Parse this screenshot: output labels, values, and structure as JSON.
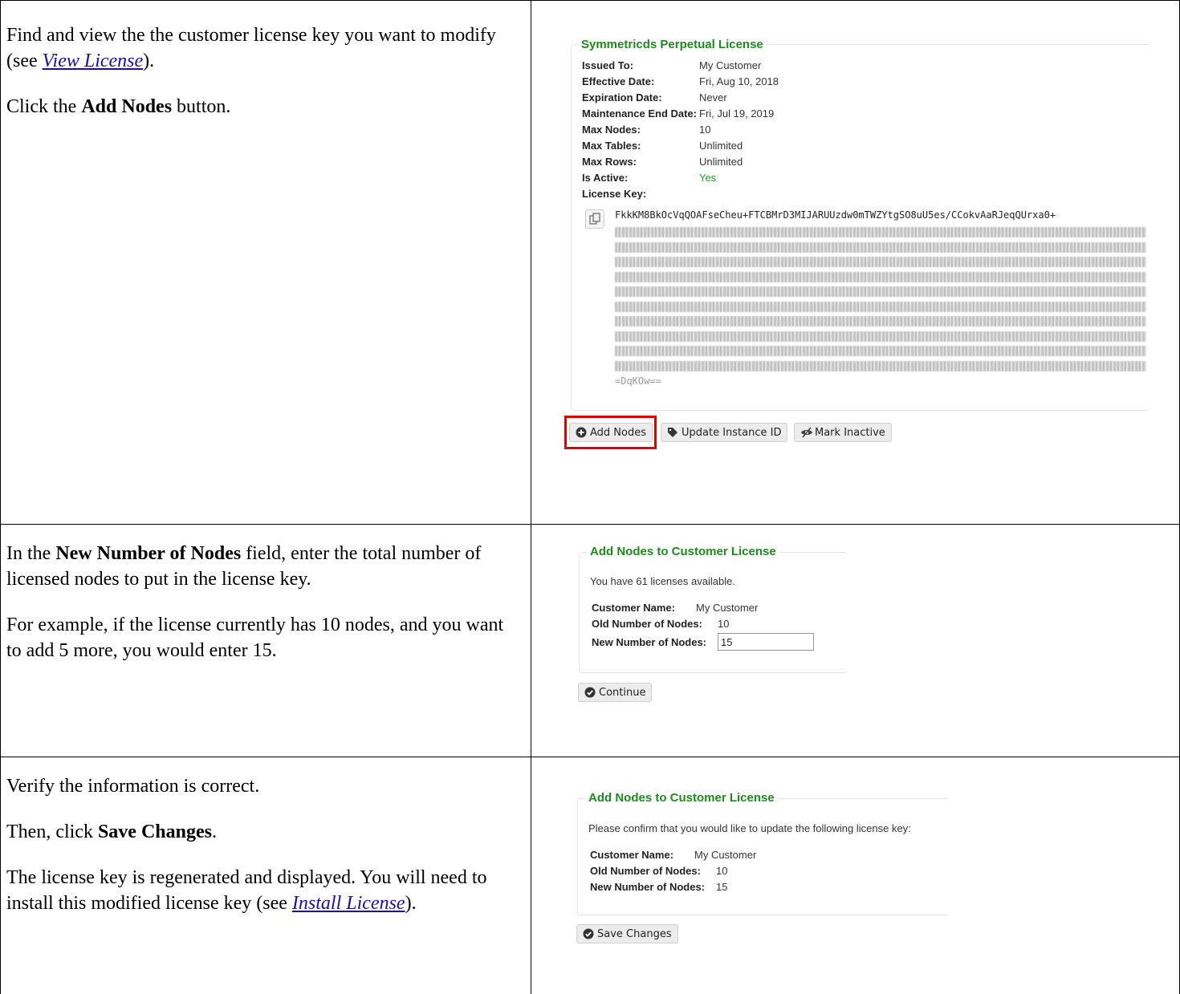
{
  "steps": [
    {
      "paragraphs": [
        {
          "before": "Find and view the the customer license key you want to modify (see ",
          "link": "View License",
          "after": ")."
        },
        {
          "before": "Click the ",
          "bold": "Add Nodes",
          "after": " button."
        }
      ]
    },
    {
      "paragraphs": [
        {
          "before": "In the ",
          "bold": "New Number of Nodes",
          "after": " field, enter the total number of licensed nodes to put in the license key."
        },
        {
          "before": "For example, if the license currently has 10 nodes, and you want to add 5 more, you would enter 15."
        }
      ]
    },
    {
      "paragraphs": [
        {
          "before": "Verify the information is correct."
        },
        {
          "before": "Then, click ",
          "bold": "Save Changes",
          "after": "."
        },
        {
          "before": "The license key is regenerated and displayed.  You will need to install this modified license key (see ",
          "link": "Install License",
          "after": ")."
        }
      ]
    }
  ],
  "license_panel": {
    "title": "Symmetricds Perpetual License",
    "fields": [
      {
        "label": "Issued To:",
        "value": "My Customer"
      },
      {
        "label": "Effective Date:",
        "value": "Fri, Aug 10, 2018"
      },
      {
        "label": "Expiration Date:",
        "value": "Never"
      },
      {
        "label": "Maintenance End Date:",
        "value": "Fri, Jul 19, 2019"
      },
      {
        "label": "Max Nodes:",
        "value": "10"
      },
      {
        "label": "Max Tables:",
        "value": "Unlimited"
      },
      {
        "label": "Max Rows:",
        "value": "Unlimited"
      },
      {
        "label": "Is Active:",
        "value": "Yes"
      }
    ],
    "license_key_label": "License Key:",
    "license_key_first_line": "FkkKM8BkOcVqQOAFseCheu+FTCBMrD3MIJARUUzdw0mTWZYtgSO8uU5es/CCokvAaRJeqQUrxa0+",
    "license_key_last_line": "=DqKOw==",
    "active_color": "#22a022",
    "buttons": {
      "add_nodes": "Add Nodes",
      "update_instance": "Update Instance ID",
      "mark_inactive": "Mark Inactive"
    },
    "highlight_color": "#e00000"
  },
  "add_nodes_panel": {
    "title": "Add Nodes to Customer License",
    "message": "You have 61 licenses available.",
    "customer_label": "Customer Name:",
    "customer_value": "My Customer",
    "old_label": "Old Number of Nodes:",
    "old_value": "10",
    "new_label": "New Number of Nodes:",
    "new_value": "15",
    "continue_label": "Continue"
  },
  "confirm_panel": {
    "title": "Add Nodes to Customer License",
    "message": "Please confirm that you would like to update the following license key:",
    "customer_label": "Customer Name:",
    "customer_value": "My Customer",
    "old_label": "Old Number of Nodes:",
    "old_value": "10",
    "new_label": "New Number of Nodes:",
    "new_value": "15",
    "save_label": "Save Changes"
  }
}
